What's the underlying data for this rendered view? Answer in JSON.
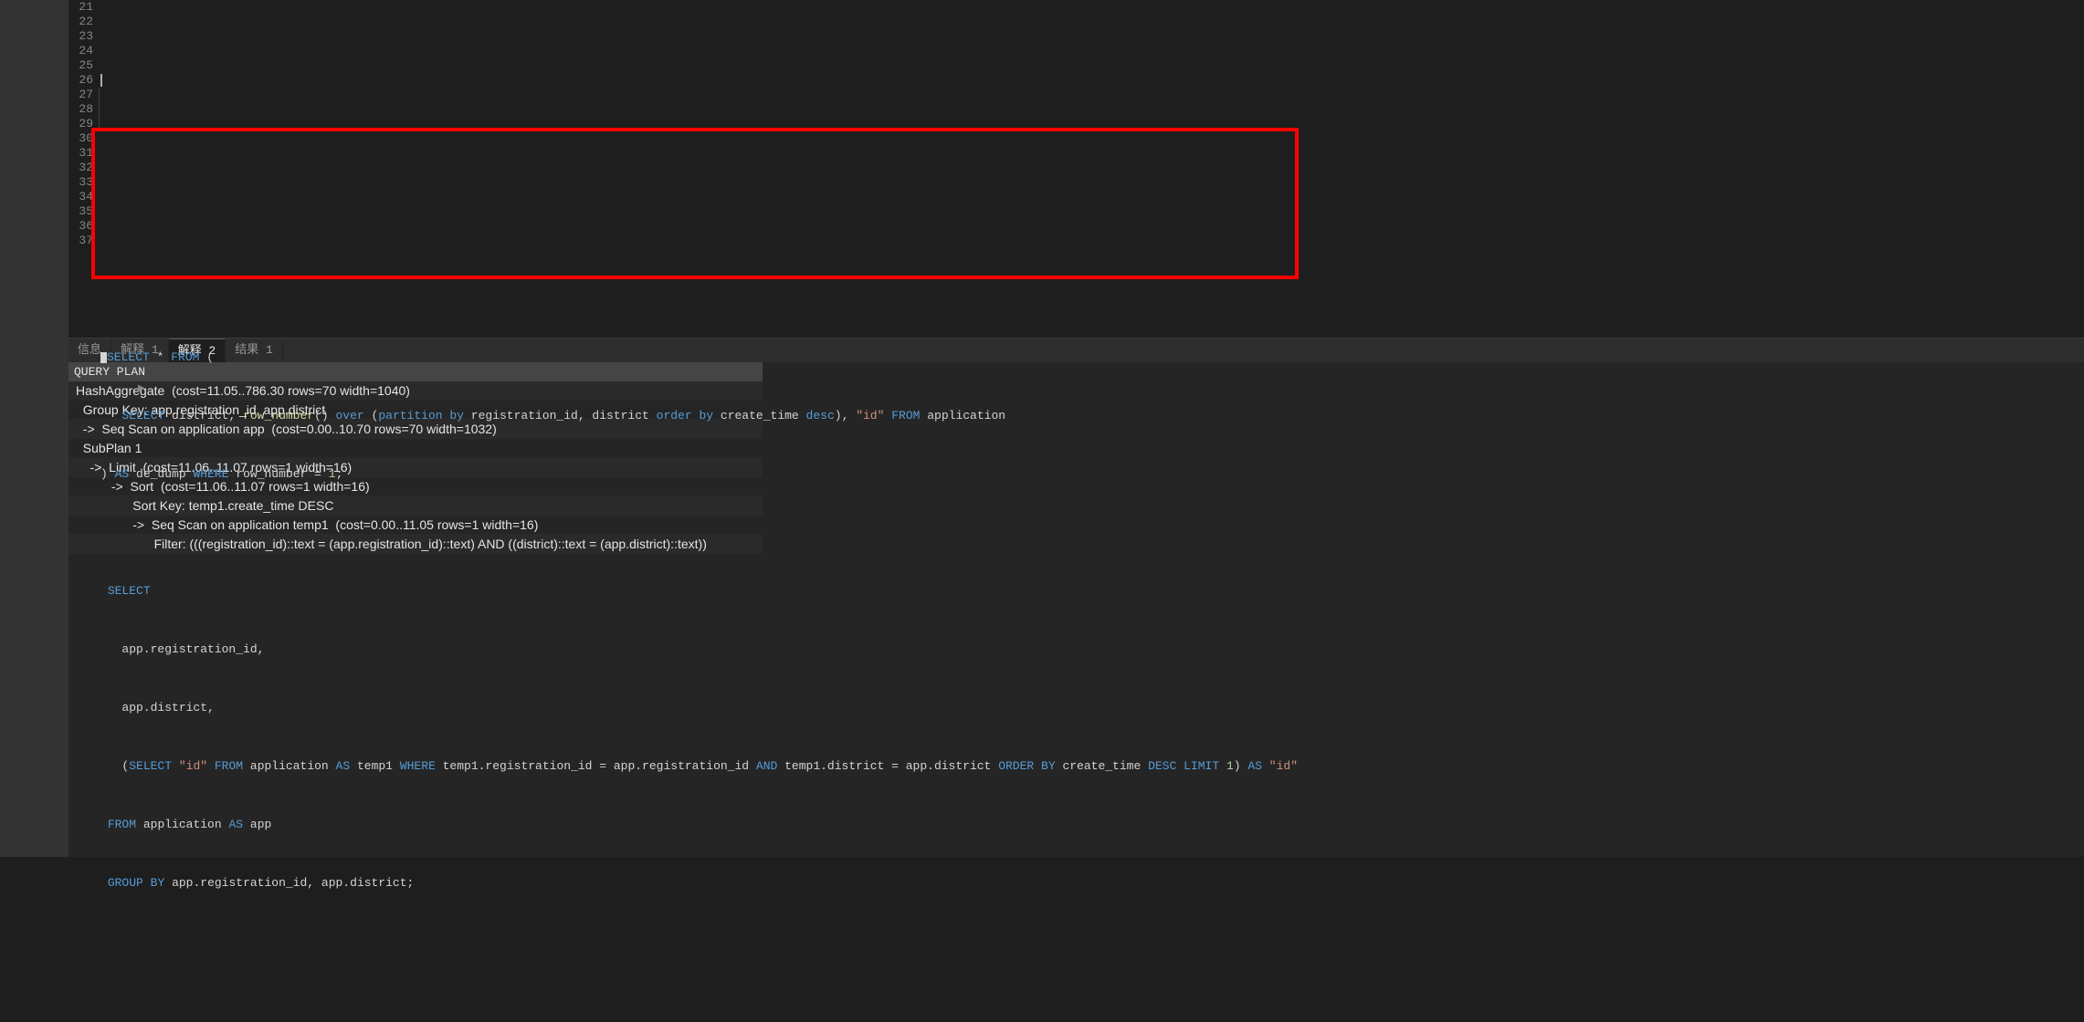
{
  "editor": {
    "line_numbers": [
      "21",
      "22",
      "23",
      "24",
      "25",
      "26",
      "27",
      "28",
      "29",
      "30",
      "31",
      "32",
      "33",
      "34",
      "35",
      "36",
      "37"
    ],
    "l27": {
      "select": "SELECT",
      "star": "*",
      "from": "FROM",
      "paren": "("
    },
    "l28": {
      "select": "SELECT",
      "c1": "district,",
      "fn": "row_number",
      "parens": "()",
      "over": "over",
      "paren": "(",
      "partition": "partition",
      "by": "by",
      "cols": "registration_id, district",
      "order": "order",
      "by2": "by",
      "col2": "create_time",
      "desc": "desc",
      "close": "),",
      "idq": "\"id\"",
      "from": "FROM",
      "tbl": "application"
    },
    "l29": {
      "paren": ")",
      "as": "AS",
      "alias": "de_dump",
      "where": "WHERE",
      "col": "row_number",
      "eq": "=",
      "num": "1",
      "semi": ";"
    },
    "l31": {
      "select": "SELECT"
    },
    "l32": {
      "col": "app.registration_id,"
    },
    "l33": {
      "col": "app.district,"
    },
    "l34": {
      "paren": "(",
      "select": "SELECT",
      "idq": "\"id\"",
      "from": "FROM",
      "tbl": "application",
      "as": "AS",
      "alias": "temp1",
      "where": "WHERE",
      "cond1": "temp1.registration_id = app.registration_id",
      "and": "AND",
      "cond2": "temp1.district = app.district",
      "order": "ORDER",
      "by": "BY",
      "col2": "create_time",
      "desc": "DESC",
      "limit": "LIMIT",
      "num": "1",
      "close": ")",
      "as2": "AS",
      "idq2": "\"id\""
    },
    "l35": {
      "from": "FROM",
      "tbl": "application",
      "as": "AS",
      "alias": "app"
    },
    "l36": {
      "group": "GROUP",
      "by": "BY",
      "cols": "app.registration_id, app.district;"
    }
  },
  "results": {
    "tabs": [
      "信息",
      "解释 1",
      "解释 2",
      "结果 1"
    ],
    "active_tab": 2,
    "plan_header": "QUERY PLAN",
    "rows": [
      "HashAggregate  (cost=11.05..786.30 rows=70 width=1040)",
      "  Group Key: app.registration_id, app.district",
      "  ->  Seq Scan on application app  (cost=0.00..10.70 rows=70 width=1032)",
      "  SubPlan 1",
      "    ->  Limit  (cost=11.06..11.07 rows=1 width=16)",
      "          ->  Sort  (cost=11.06..11.07 rows=1 width=16)",
      "                Sort Key: temp1.create_time DESC",
      "                ->  Seq Scan on application temp1  (cost=0.00..11.05 rows=1 width=16)",
      "                      Filter: (((registration_id)::text = (app.registration_id)::text) AND ((district)::text = (app.district)::text))"
    ]
  },
  "highlight_box": {
    "top_line": 30,
    "bottom_line": 37
  }
}
